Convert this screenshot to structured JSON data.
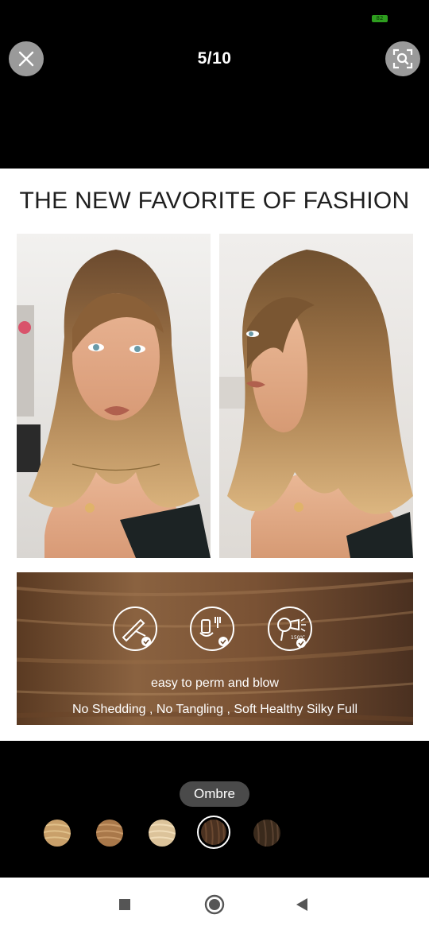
{
  "status_bar": {
    "battery_level": "82"
  },
  "top_bar": {
    "page_counter": "5/10",
    "close_icon": "close-icon",
    "image_search_icon": "image-search-icon"
  },
  "product_image": {
    "headline": "THE NEW FAVORITE OF FASHION",
    "banner": {
      "icons": [
        "flat-iron-icon",
        "wash-brush-icon",
        "hair-dryer-icon"
      ],
      "dryer_temperature": "150℃",
      "line1": "easy to perm and blow",
      "line2": "No Shedding , No Tangling , Soft Healthy Silky Full"
    }
  },
  "variants": {
    "selected_label": "Ombre",
    "swatches": [
      {
        "name": "light-brown",
        "color": "#c9a06a",
        "selected": false
      },
      {
        "name": "honey-brown",
        "color": "#a9784a",
        "selected": false
      },
      {
        "name": "blonde",
        "color": "#dcc39a",
        "selected": false
      },
      {
        "name": "ombre",
        "color": "#4b3221",
        "selected": true
      },
      {
        "name": "dark-brown",
        "color": "#3a2a1c",
        "selected": false
      }
    ]
  },
  "nav_bar": {
    "icons": [
      "recent-apps-icon",
      "home-icon",
      "back-icon"
    ]
  },
  "colors": {
    "background": "#000000",
    "accent_white": "#ffffff",
    "pill": "#4a4a4a"
  }
}
